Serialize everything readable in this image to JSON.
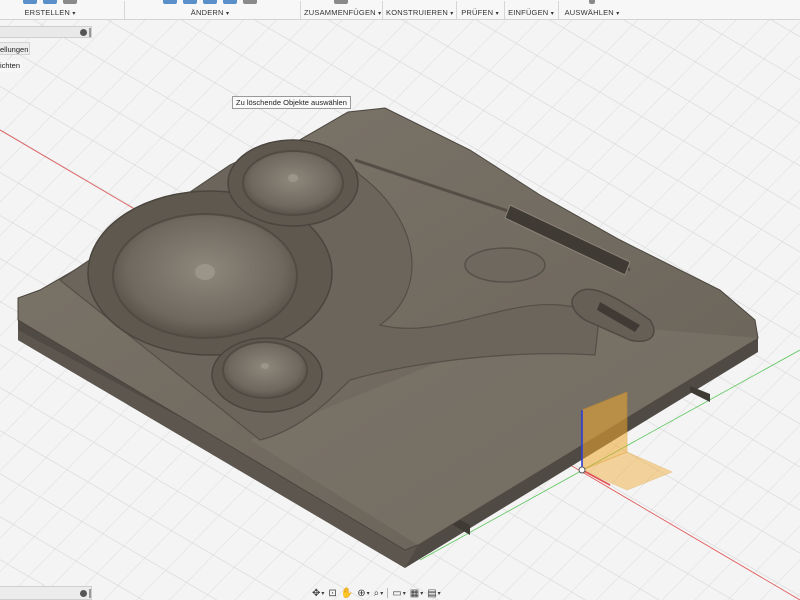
{
  "toolbar": {
    "groups": [
      {
        "label": "ERSTELLEN"
      },
      {
        "label": "ÄNDERN"
      },
      {
        "label": "ZUSAMMENFÜGEN"
      },
      {
        "label": "KONSTRUIEREN"
      },
      {
        "label": "PRÜFEN"
      },
      {
        "label": "EINFÜGEN"
      },
      {
        "label": "AUSWÄHLEN"
      }
    ],
    "caret": "▾"
  },
  "browser": {
    "items": [
      {
        "label": "ellungen"
      },
      {
        "label": "ichten"
      }
    ]
  },
  "viewport": {
    "tooltip": "Zu löschende Objekte auswählen",
    "colors": {
      "background": "#f4f4f4",
      "grid": "#d8d8d8",
      "model": "#716a60",
      "x_axis": "#e05050",
      "y_axis": "#5cc65c",
      "z_axis": "#2a3fd8",
      "plane": "#f0a830"
    }
  },
  "navbar": {
    "icons": [
      "orbit-icon",
      "look-at-icon",
      "pan-icon",
      "zoom-icon",
      "fit-icon",
      "display-settings-icon",
      "grid-settings-icon",
      "viewports-icon"
    ],
    "glyphs": {
      "orbit": "✥",
      "look_at": "⊡",
      "pan": "✋",
      "zoom": "⊕",
      "fit": "⌕",
      "display": "▭",
      "grid": "▦",
      "viewports": "▤"
    }
  }
}
